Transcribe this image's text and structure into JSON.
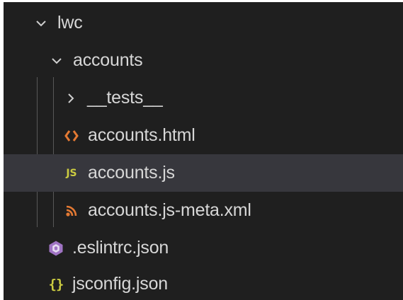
{
  "explorer": {
    "items": [
      {
        "label": "lwc",
        "kind": "folder",
        "expanded": true,
        "icon": "chevron-down-icon"
      },
      {
        "label": "accounts",
        "kind": "folder",
        "expanded": true,
        "icon": "chevron-down-icon"
      },
      {
        "label": "__tests__",
        "kind": "folder",
        "expanded": false,
        "icon": "chevron-right-icon"
      },
      {
        "label": "accounts.html",
        "kind": "file",
        "icon": "html-icon"
      },
      {
        "label": "accounts.js",
        "kind": "file",
        "icon": "javascript-icon",
        "badge": "JS",
        "selected": true
      },
      {
        "label": "accounts.js-meta.xml",
        "kind": "file",
        "icon": "rss-xml-icon"
      },
      {
        "label": ".eslintrc.json",
        "kind": "file",
        "icon": "eslint-icon"
      },
      {
        "label": "jsconfig.json",
        "kind": "file",
        "icon": "json-icon",
        "badge": "{}"
      }
    ]
  },
  "colors": {
    "panel_background": "#1f1f1f",
    "selected_row": "#37373d",
    "text": "#d7d7d7",
    "html_icon": "#e37933",
    "js_icon": "#cbcb41",
    "xml_icon": "#e37933",
    "eslint_icon": "#a074c4",
    "json_icon": "#cbcb41"
  }
}
